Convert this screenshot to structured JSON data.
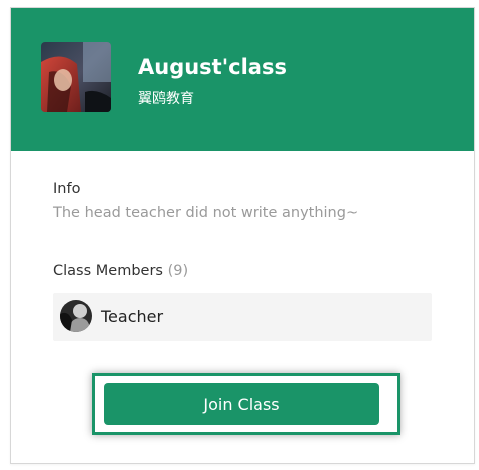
{
  "header": {
    "class_name": "August'class",
    "school_name": "翼鸥教育"
  },
  "info": {
    "label": "Info",
    "text": "The head teacher did not write anything~"
  },
  "members": {
    "label": "Class Members",
    "count": "(9)",
    "list": [
      {
        "name": "Teacher",
        "avatar_icon": "user-photo"
      }
    ]
  },
  "actions": {
    "join_label": "Join Class"
  },
  "colors": {
    "brand_green": "#1a9468",
    "muted_text": "#9a9a9a",
    "row_background": "#f4f4f4"
  }
}
